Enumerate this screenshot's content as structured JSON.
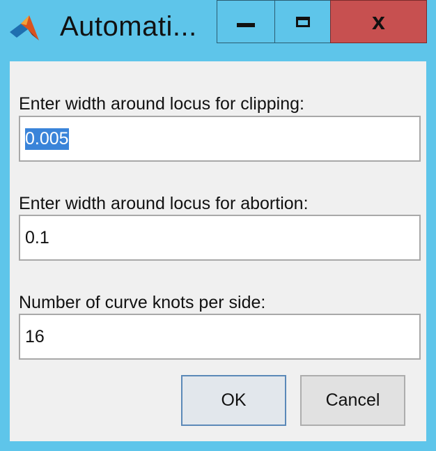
{
  "window": {
    "title": "Automati...",
    "app_icon": "matlab-logo-icon",
    "controls": {
      "minimize_icon": "minimize-icon",
      "maximize_icon": "maximize-icon",
      "close_glyph": "x"
    },
    "colors": {
      "frame": "#5ec5ea",
      "close": "#c75050",
      "dialog": "#f0f0f0",
      "selection": "#3a84d9"
    }
  },
  "dialog": {
    "fields": [
      {
        "label": "Enter width around locus for clipping:",
        "value": "0.005"
      },
      {
        "label": "Enter width around locus for abortion:",
        "value": "0.1"
      },
      {
        "label": "Number of curve knots per side:",
        "value": "16"
      }
    ],
    "buttons": {
      "ok": "OK",
      "cancel": "Cancel"
    }
  }
}
